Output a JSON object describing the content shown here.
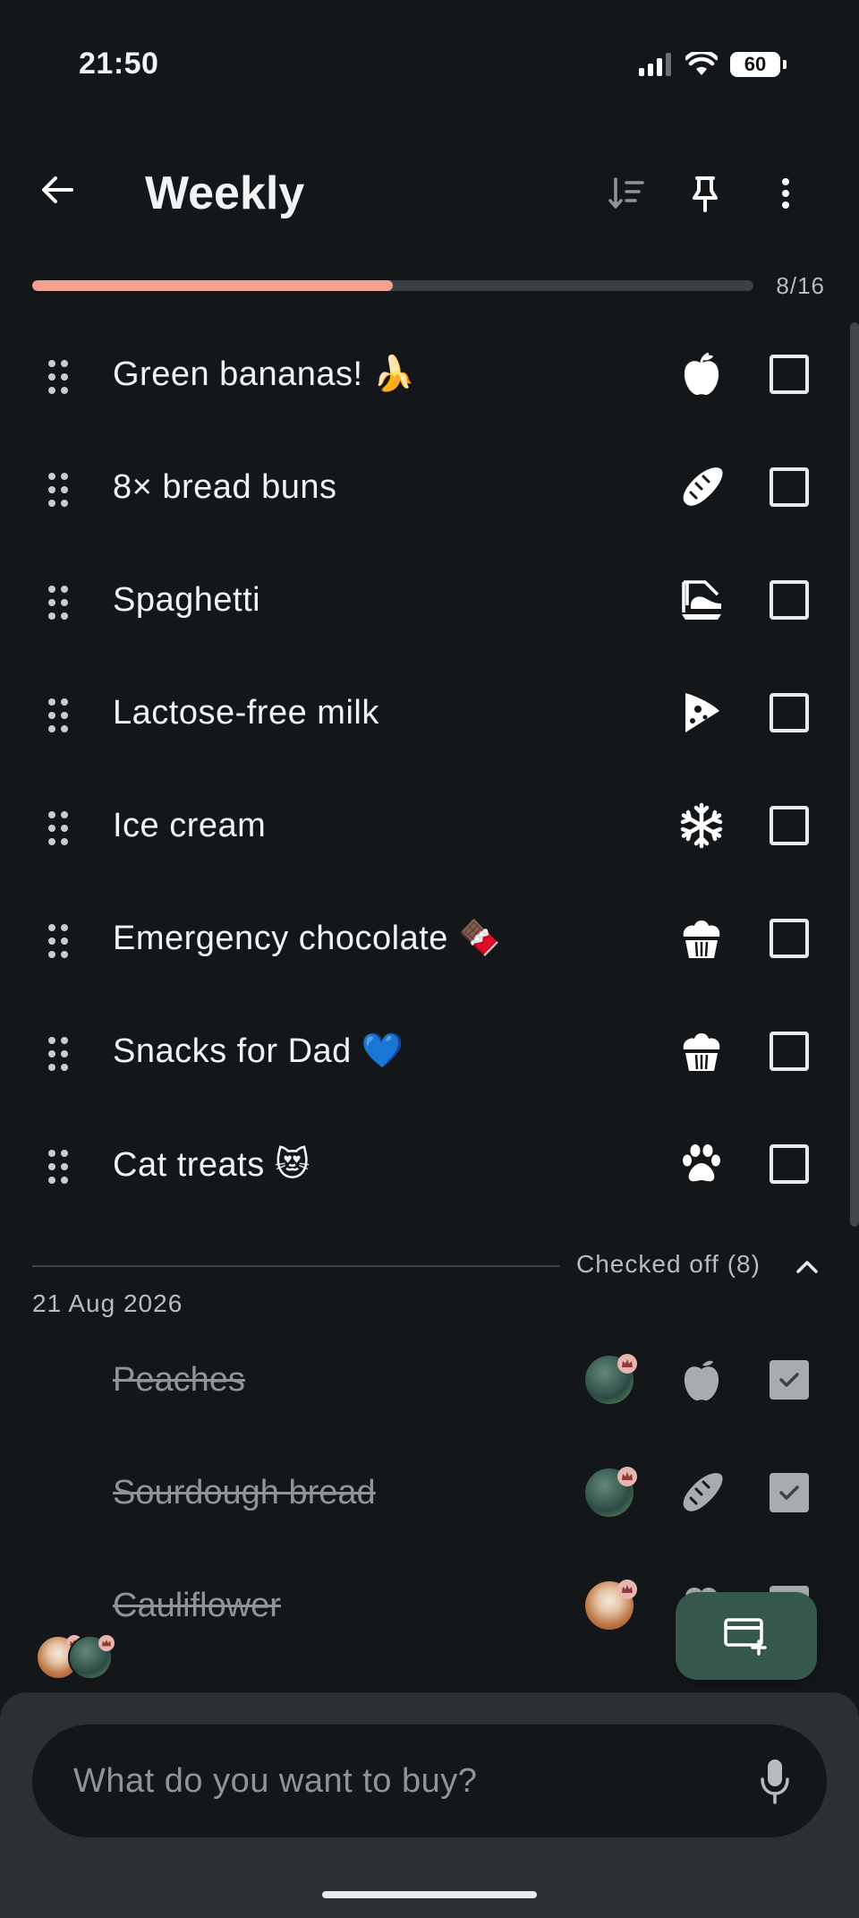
{
  "status_bar": {
    "time": "21:50",
    "battery": "60"
  },
  "header": {
    "title": "Weekly"
  },
  "progress": {
    "done": 8,
    "total": 16,
    "fraction": 0.5,
    "label": "8/16"
  },
  "items": [
    {
      "label": "Green bananas! 🍌",
      "category_icon": "apple-icon"
    },
    {
      "label": "8× bread buns",
      "category_icon": "bread-icon"
    },
    {
      "label": "Spaghetti",
      "category_icon": "pasta-icon"
    },
    {
      "label": "Lactose-free milk",
      "category_icon": "cheese-icon"
    },
    {
      "label": "Ice cream",
      "category_icon": "snowflake-icon"
    },
    {
      "label": "Emergency chocolate 🍫",
      "category_icon": "cupcake-icon"
    },
    {
      "label": "Snacks for Dad 💙",
      "category_icon": "cupcake-icon"
    },
    {
      "label": "Cat treats 😻",
      "category_icon": "paw-icon"
    }
  ],
  "checked_section": {
    "label": "Checked off (8)",
    "date": "21 Aug 2026",
    "items": [
      {
        "label": "Peaches",
        "category_icon": "apple-icon",
        "checked": true
      },
      {
        "label": "Sourdough bread",
        "category_icon": "bread-icon",
        "checked": true
      },
      {
        "label": "Cauliflower",
        "category_icon": "broccoli-icon",
        "checked": true
      }
    ]
  },
  "input": {
    "placeholder": "What do you want to buy?"
  },
  "colors": {
    "background": "#14171a",
    "accent": "#f2a091",
    "fab": "#36574b",
    "panel": "#2b3035"
  }
}
